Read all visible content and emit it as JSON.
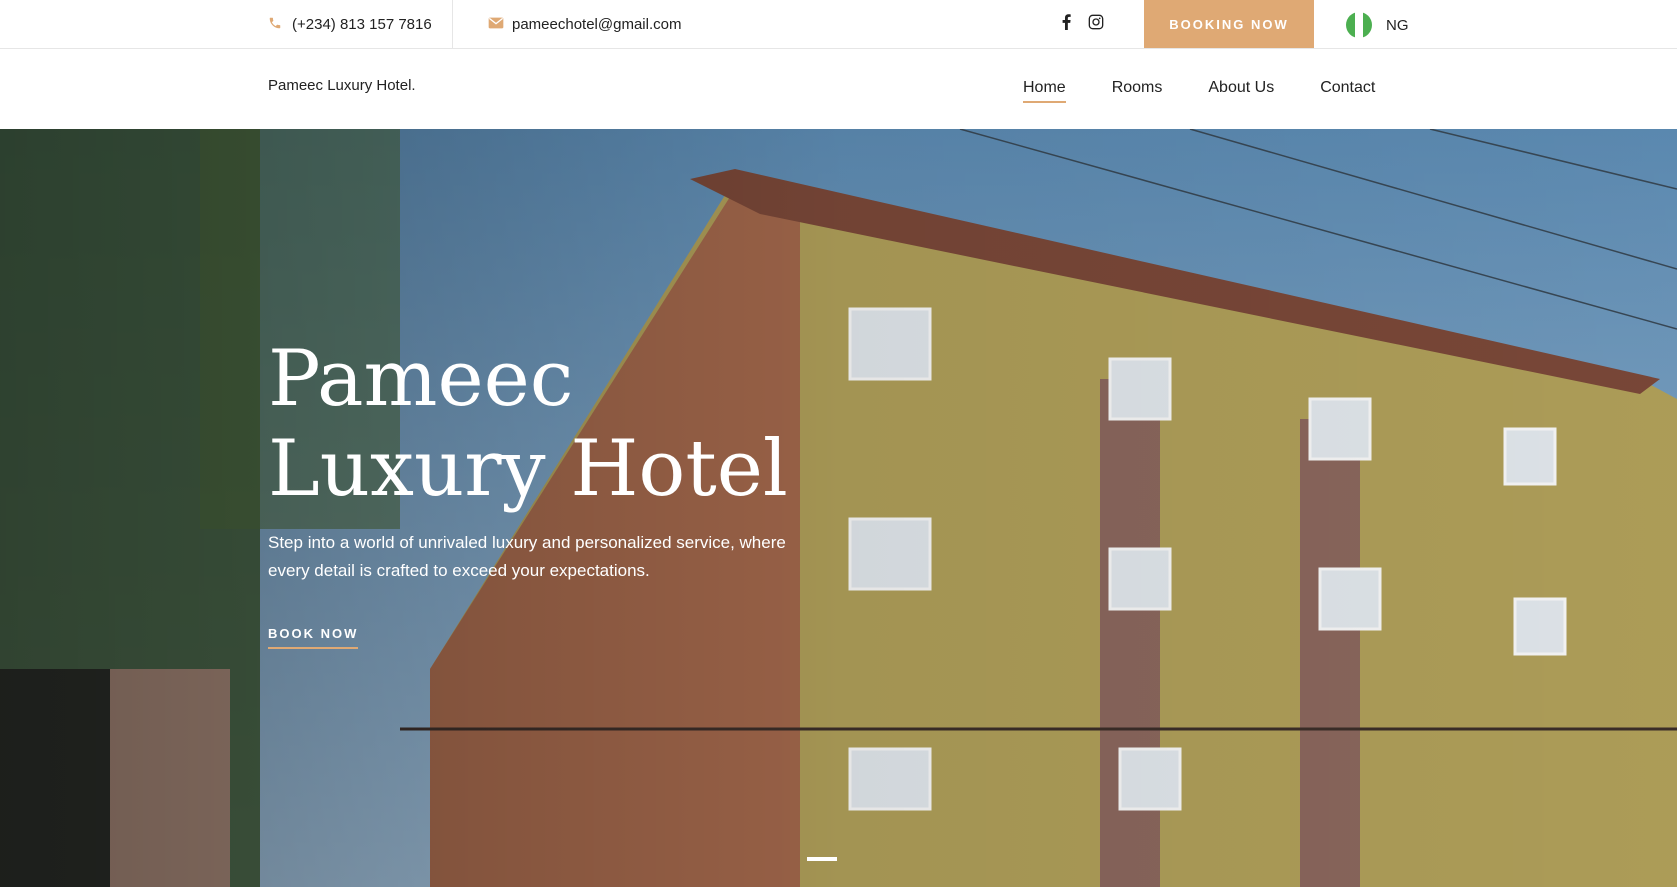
{
  "topbar": {
    "phone": "(+234) 813 157 7816",
    "email": "pameechotel@gmail.com",
    "social": [
      "facebook-icon",
      "instagram-icon"
    ],
    "booking_label": "BOOKING NOW",
    "language": "NG",
    "accent": "#dfa974"
  },
  "nav": {
    "brand": "Pameec Luxury Hotel.",
    "items": [
      {
        "label": "Home",
        "active": true
      },
      {
        "label": "Rooms"
      },
      {
        "label": "About Us"
      },
      {
        "label": "Contact"
      }
    ]
  },
  "hero": {
    "title_line1": "Pameec",
    "title_line2": "Luxury Hotel",
    "text": "Step into a world of unrivaled luxury and personalized service, where every detail is crafted to exceed your expectations.",
    "cta_label": "BOOK NOW",
    "slide_count": 1
  }
}
